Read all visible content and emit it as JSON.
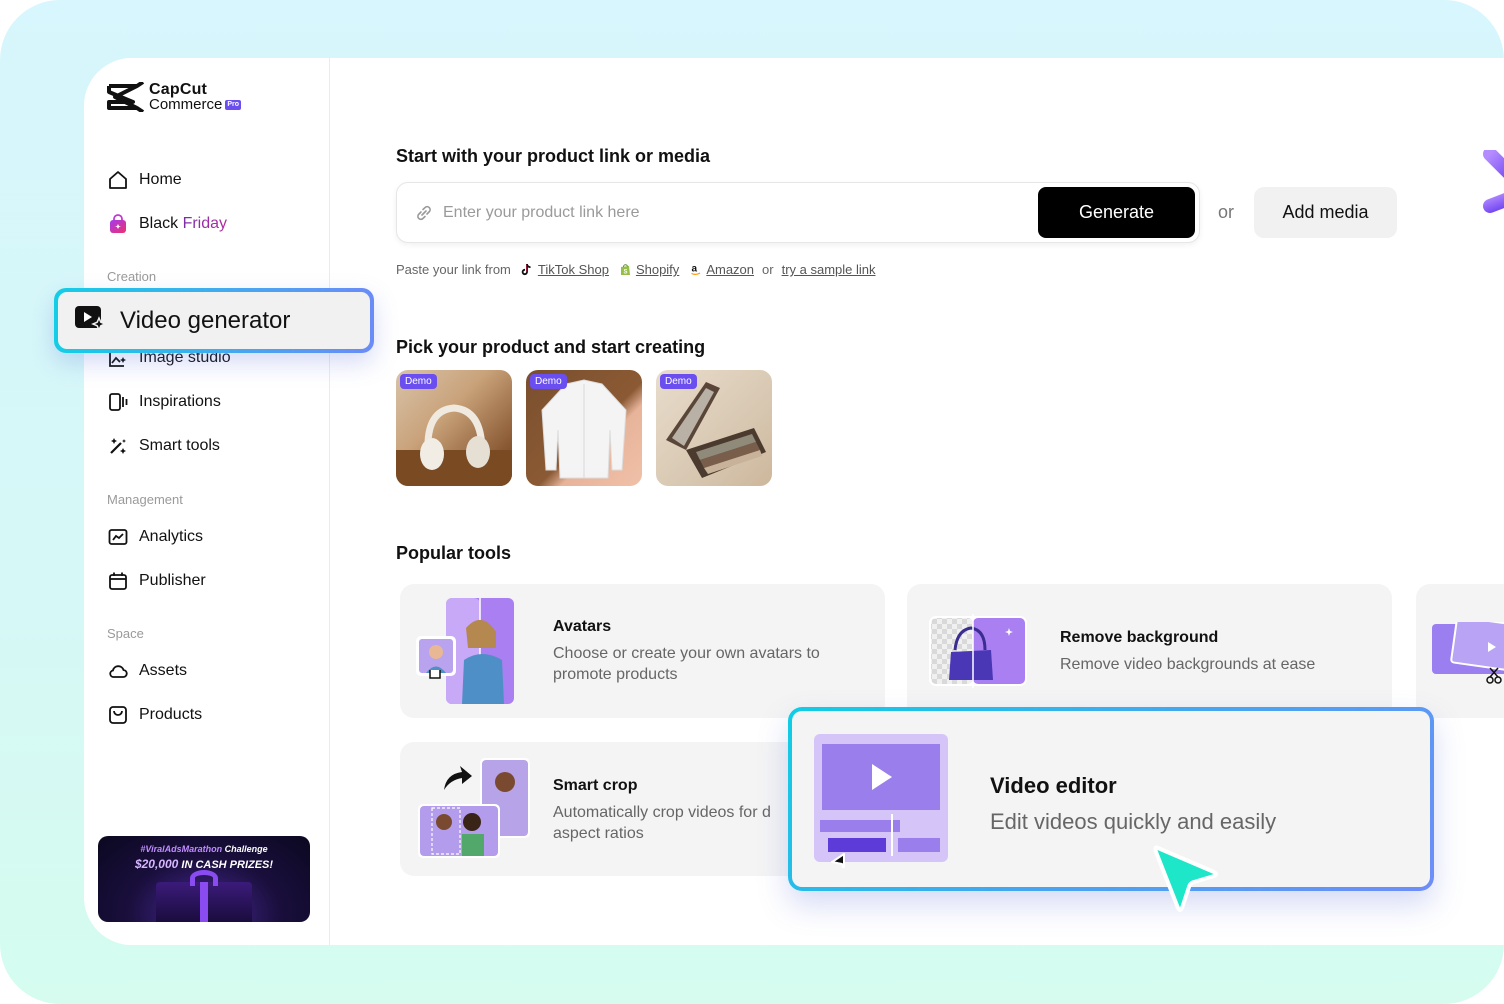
{
  "brand": {
    "name_line1": "CapCut",
    "name_line2": "Commerce",
    "badge": "Pro"
  },
  "sidebar": {
    "items": [
      {
        "id": "home",
        "label": "Home",
        "icon": "home-icon"
      },
      {
        "id": "black-friday",
        "label_prefix": "Black ",
        "label_highlight": "Friday",
        "icon": "shopping-bag-icon"
      }
    ],
    "sections": [
      {
        "label": "Creation",
        "items": [
          {
            "id": "video-generator",
            "label": "Video generator",
            "icon": "video-sparkle-icon",
            "active": true
          },
          {
            "id": "image-studio",
            "label": "Image studio",
            "icon": "image-sparkle-icon"
          },
          {
            "id": "inspirations",
            "label": "Inspirations",
            "icon": "inspirations-icon"
          },
          {
            "id": "smart-tools",
            "label": "Smart tools",
            "icon": "magic-wand-icon"
          }
        ]
      },
      {
        "label": "Management",
        "items": [
          {
            "id": "analytics",
            "label": "Analytics",
            "icon": "analytics-icon"
          },
          {
            "id": "publisher",
            "label": "Publisher",
            "icon": "calendar-icon"
          }
        ]
      },
      {
        "label": "Space",
        "items": [
          {
            "id": "assets",
            "label": "Assets",
            "icon": "cloud-icon"
          },
          {
            "id": "products",
            "label": "Products",
            "icon": "product-box-icon"
          }
        ]
      }
    ],
    "promo": {
      "line1_tag": "#ViralAdsMarathon",
      "line1_rest": " Challenge",
      "line2_amount": "$20,000",
      "line2_rest": " IN CASH PRIZES!"
    }
  },
  "main": {
    "start_section": {
      "heading": "Start with your product link or media",
      "input_placeholder": "Enter your product link here",
      "input_value": "",
      "generate_label": "Generate",
      "or_label": "or",
      "add_media_label": "Add media",
      "hint_prefix": "Paste your link from",
      "sources": [
        {
          "label": "TikTok Shop",
          "icon": "tiktok-icon"
        },
        {
          "label": "Shopify",
          "icon": "shopify-icon"
        },
        {
          "label": "Amazon",
          "icon": "amazon-icon"
        }
      ],
      "hint_or": "or",
      "sample_link": "try a sample link"
    },
    "pick_section": {
      "heading": "Pick your product and start creating",
      "products": [
        {
          "badge": "Demo",
          "subject": "White headphones"
        },
        {
          "badge": "Demo",
          "subject": "White dress shirt"
        },
        {
          "badge": "Demo",
          "subject": "Eyeshadow palette"
        }
      ]
    },
    "popular_tools": {
      "heading": "Popular tools",
      "tools": [
        {
          "title": "Avatars",
          "desc": "Choose or create your own avatars to promote products"
        },
        {
          "title": "Remove background",
          "desc": "Remove video backgrounds at ease"
        },
        {
          "title": "Smart crop",
          "desc": "Automatically crop videos for different aspect ratios",
          "desc_visible": "Automatically crop videos for d",
          "desc_line2": "aspect ratios"
        },
        {
          "title": "Video editor",
          "desc": "Edit videos quickly and easily"
        }
      ]
    }
  },
  "colors": {
    "accent_purple": "#6a4ef0",
    "highlight_cyan": "#14cde6",
    "highlight_blue": "#6b8bf7",
    "cursor_teal": "#1de6c9"
  }
}
